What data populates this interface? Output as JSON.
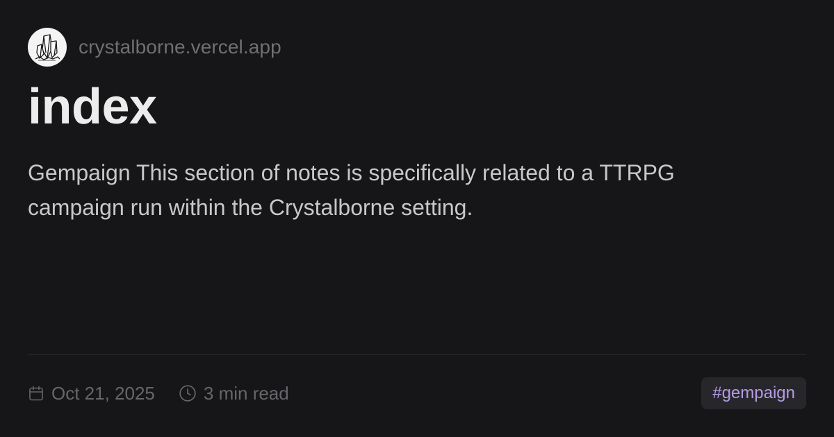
{
  "site": {
    "name": "crystalborne.vercel.app",
    "avatar_icon": "crystal-cluster-icon"
  },
  "page": {
    "title": "index",
    "description": "Gempaign This section of notes is specifically related to a TTRPG campaign run within the Crystalborne setting."
  },
  "meta": {
    "date_icon": "calendar-icon",
    "date": "Oct 21, 2025",
    "reading_icon": "clock-icon",
    "reading_time": "3 min read"
  },
  "tags": [
    {
      "label": "#gempaign"
    }
  ],
  "colors": {
    "background": "#161618",
    "title": "#ececec",
    "text": "#c8c8cc",
    "muted": "#66666b",
    "tag_text": "#b59be6",
    "tag_background": "#27272b"
  }
}
